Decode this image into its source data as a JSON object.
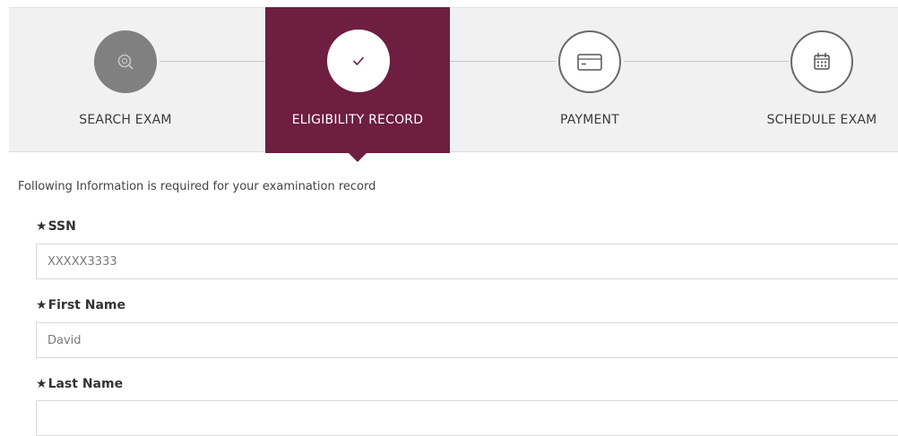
{
  "stepper": {
    "steps": [
      {
        "label": "SEARCH EXAM",
        "icon": "search-icon",
        "state": "complete"
      },
      {
        "label": "ELIGIBILITY RECORD",
        "icon": "check-icon",
        "state": "active"
      },
      {
        "label": "PAYMENT",
        "icon": "credit-card-icon",
        "state": "pending"
      },
      {
        "label": "SCHEDULE EXAM",
        "icon": "calendar-icon",
        "state": "pending"
      }
    ],
    "colors": {
      "active_bg": "#6d1e41",
      "complete_circle": "#808080",
      "bar_bg": "#f1f1f1"
    }
  },
  "form": {
    "intro": "Following Information is required for your examination record",
    "required_marker": "★",
    "fields": [
      {
        "label": "SSN",
        "value": "XXXXX3333"
      },
      {
        "label": "First Name",
        "value": "David"
      },
      {
        "label": "Last Name",
        "value": ""
      }
    ]
  }
}
